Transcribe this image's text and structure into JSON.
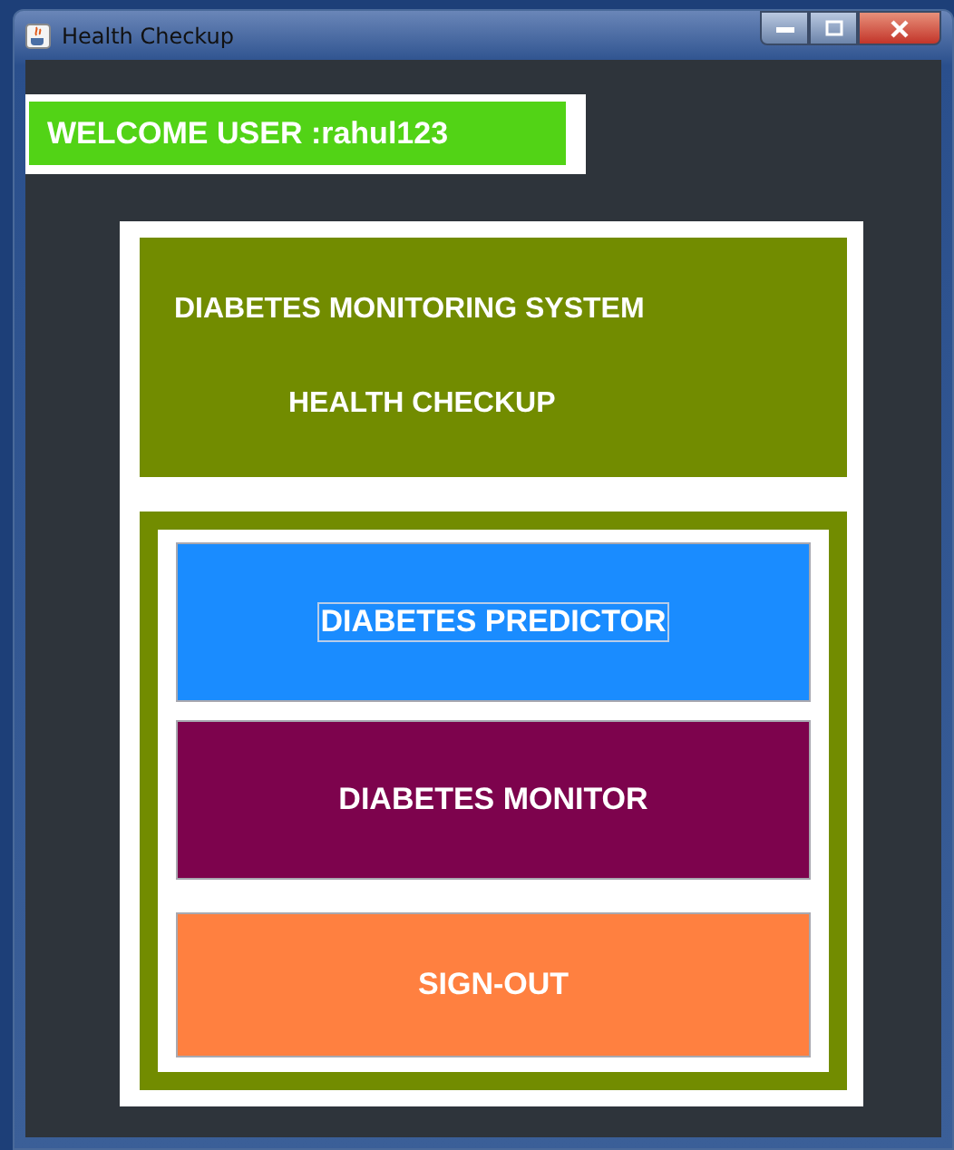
{
  "window": {
    "title": "Health Checkup"
  },
  "welcome": {
    "text": "WELCOME USER :rahul123"
  },
  "header": {
    "lines": [
      "DIABETES MONITORING SYSTEM",
      "HEALTH CHECKUP"
    ]
  },
  "buttons": [
    {
      "label": "DIABETES PREDICTOR",
      "color": "#1a8cff",
      "focused": true
    },
    {
      "label": "DIABETES MONITOR",
      "color": "#7d034d",
      "focused": false
    },
    {
      "label": "SIGN-OUT",
      "color": "#ff8040",
      "focused": false
    }
  ]
}
